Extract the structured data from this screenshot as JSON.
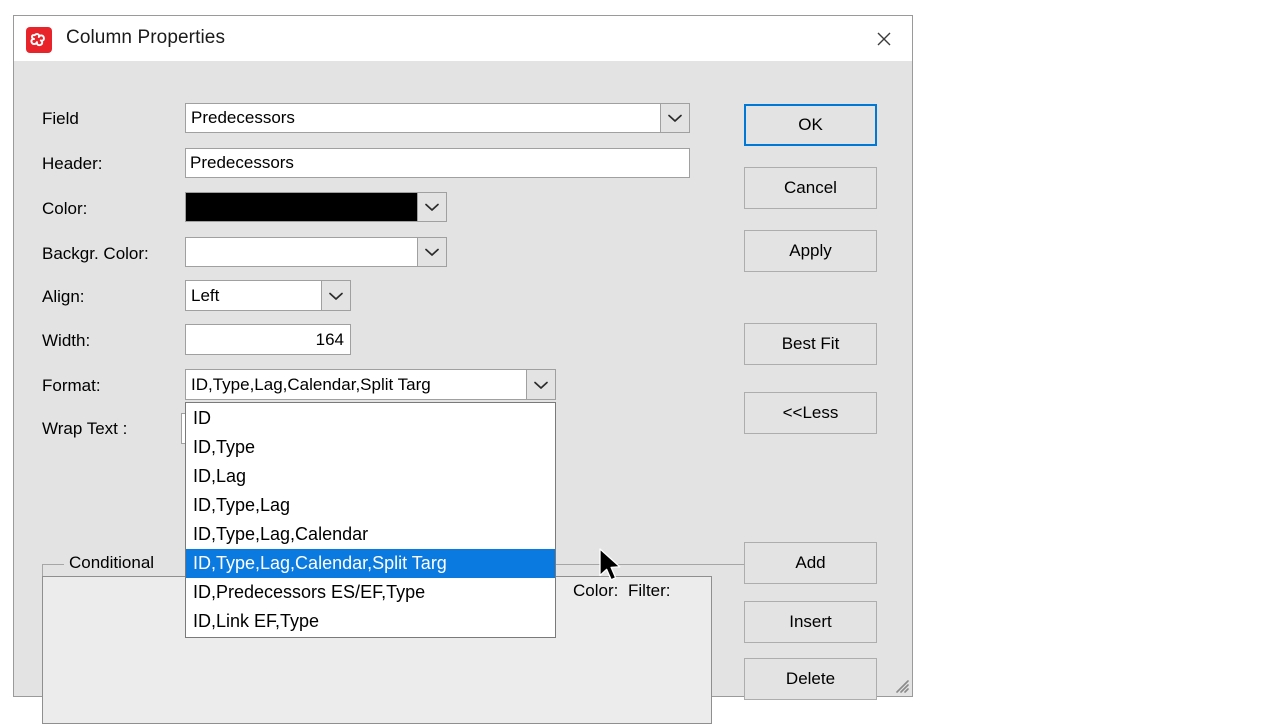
{
  "window": {
    "title": "Column Properties",
    "icon": "app-logo-icon",
    "close_icon": "close-icon",
    "accent_color": "#0078d7",
    "brand_color": "#e8232a",
    "body_color": "#e3e3e3",
    "highlight_color": "#0a7ae0"
  },
  "form": {
    "fields": [
      {
        "label": "Field",
        "value": "Predecessors",
        "control": "combobox"
      },
      {
        "label": "Header:",
        "value": "Predecessors",
        "control": "textbox"
      },
      {
        "label": "Color:",
        "value": "",
        "swatch": "#000000",
        "control": "color-combobox"
      },
      {
        "label": "Backgr. Color:",
        "value": "",
        "swatch": "#ffffff",
        "control": "color-combobox"
      },
      {
        "label": "Align:",
        "value": "Left",
        "control": "combobox"
      },
      {
        "label": "Width:",
        "value": "164",
        "control": "textbox"
      },
      {
        "label": "Format:",
        "value": "ID,Type,Lag,Calendar,Split Targ",
        "control": "combobox"
      },
      {
        "label": "Wrap Text :",
        "value": "",
        "control": "checkbox"
      }
    ]
  },
  "format_dropdown": {
    "open": true,
    "selected_index": 5,
    "options": [
      "ID",
      "ID,Type",
      "ID,Lag",
      "ID,Type,Lag",
      "ID,Type,Lag,Calendar",
      "ID,Type,Lag,Calendar,Split Targ",
      "ID,Predecessors ES/EF,Type",
      "ID,Link EF,Type"
    ]
  },
  "conditional": {
    "group_label": "Conditional",
    "columns": [
      "Color:",
      "Filter:"
    ],
    "rows": []
  },
  "buttons": {
    "ok": "OK",
    "cancel": "Cancel",
    "apply": "Apply",
    "best_fit": "Best Fit",
    "less": "<<Less",
    "add": "Add",
    "insert": "Insert",
    "delete": "Delete"
  }
}
